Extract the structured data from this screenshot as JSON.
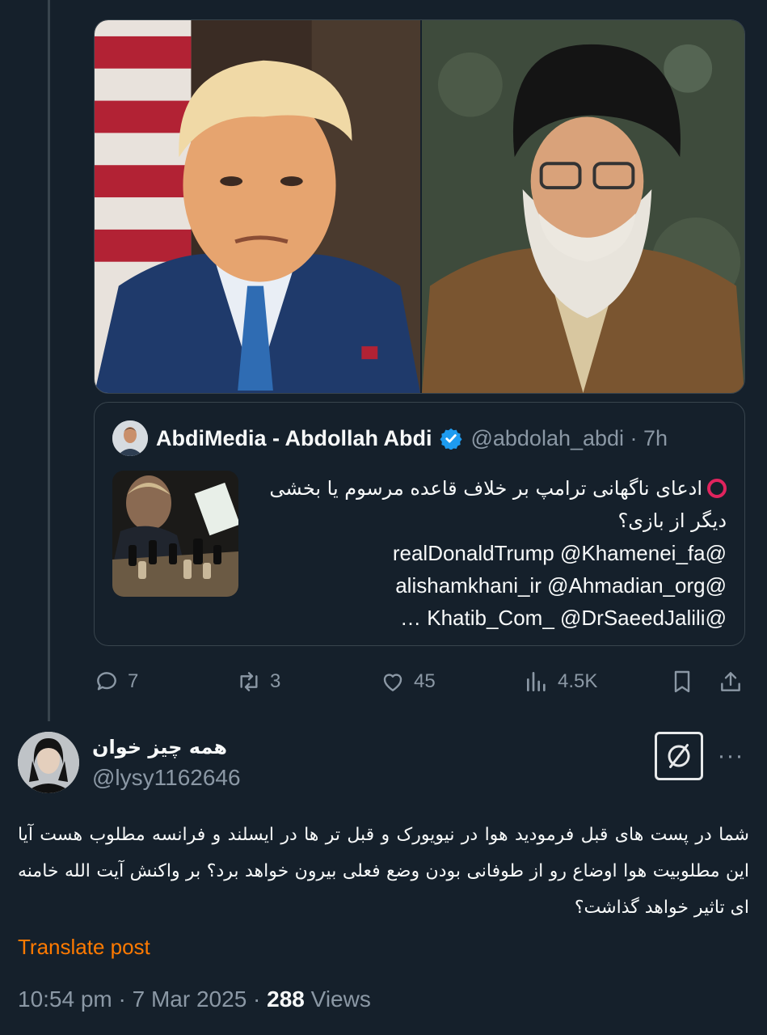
{
  "quoted_tweet": {
    "author_name": "AbdiMedia - Abdollah Abdi",
    "handle_time": "@abdolah_abdi · 7h",
    "text_line_1": "ادعای ناگهانی ترامپ بر خلاف قاعده مرسوم یا بخشی",
    "text_line_2": "دیگر از بازی؟",
    "mentions_line_1": "@realDonaldTrump @Khamenei_fa",
    "mentions_line_2": "@alishamkhani_ir @Ahmadian_org",
    "mentions_line_3": "@Khatib_Com_ @DrSaeedJalili …"
  },
  "actions": {
    "replies": "7",
    "reposts": "3",
    "likes": "45",
    "views": "4.5K"
  },
  "reply": {
    "display_name": "همه چیز خوان",
    "handle": "@lysy1162646",
    "body": "شما در پست های قبل فرمودید هوا در نیویورک و قبل تر ها در ایسلند و فرانسه مطلوب هست آیا این مطلوبیت هوا اوضاع رو از طوفانی بودن وضع فعلی بیرون خواهد برد؟ بر واکنش آیت الله خامنه ای تاثیر خواهد گذاشت؟",
    "translate_label": "Translate post",
    "timestamp": "10:54 pm · 7 Mar 2025 · ",
    "views_count": "288",
    "views_label": " Views"
  },
  "colors": {
    "background": "#15202b",
    "border": "#38444d",
    "muted": "#8b98a5",
    "verified": "#1d9bf0",
    "translate": "#ff7a00"
  }
}
